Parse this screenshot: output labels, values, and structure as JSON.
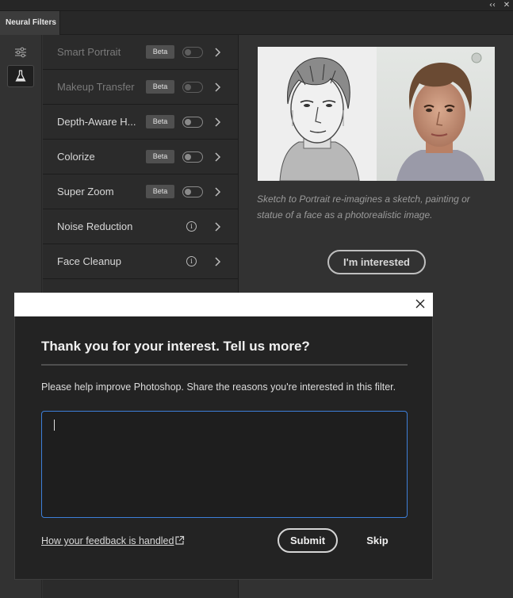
{
  "window": {
    "collapse_glyph": "‹‹",
    "close_glyph": "✕"
  },
  "tabs": [
    {
      "label": "Neural Filters"
    }
  ],
  "sidebar": {
    "icons": [
      "sliders-icon",
      "flask-icon"
    ]
  },
  "filters": [
    {
      "label": "Smart Portrait",
      "badge": "Beta",
      "control": "toggle",
      "dimmed": true
    },
    {
      "label": "Makeup Transfer",
      "badge": "Beta",
      "control": "toggle",
      "dimmed": true
    },
    {
      "label": "Depth-Aware H...",
      "badge": "Beta",
      "control": "toggle",
      "dimmed": false
    },
    {
      "label": "Colorize",
      "badge": "Beta",
      "control": "toggle",
      "dimmed": false
    },
    {
      "label": "Super Zoom",
      "badge": "Beta",
      "control": "toggle",
      "dimmed": false
    },
    {
      "label": "Noise Reduction",
      "control": "info",
      "dimmed": false
    },
    {
      "label": "Face Cleanup",
      "control": "info",
      "dimmed": false
    }
  ],
  "detail": {
    "description": "Sketch to Portrait re-imagines a sketch, painting or statue of a face as a photorealistic image.",
    "interest_button": "I'm interested"
  },
  "modal": {
    "title": "Thank you for your interest. Tell us more?",
    "subtitle": "Please help improve Photoshop. Share the reasons you're interested in this filter.",
    "textarea_value": "",
    "link_text": "How your feedback is handled",
    "submit_label": "Submit",
    "skip_label": "Skip"
  },
  "colors": {
    "accent_focus": "#3d7fd9",
    "panel_bg": "#323232",
    "modal_bg": "#232323"
  }
}
